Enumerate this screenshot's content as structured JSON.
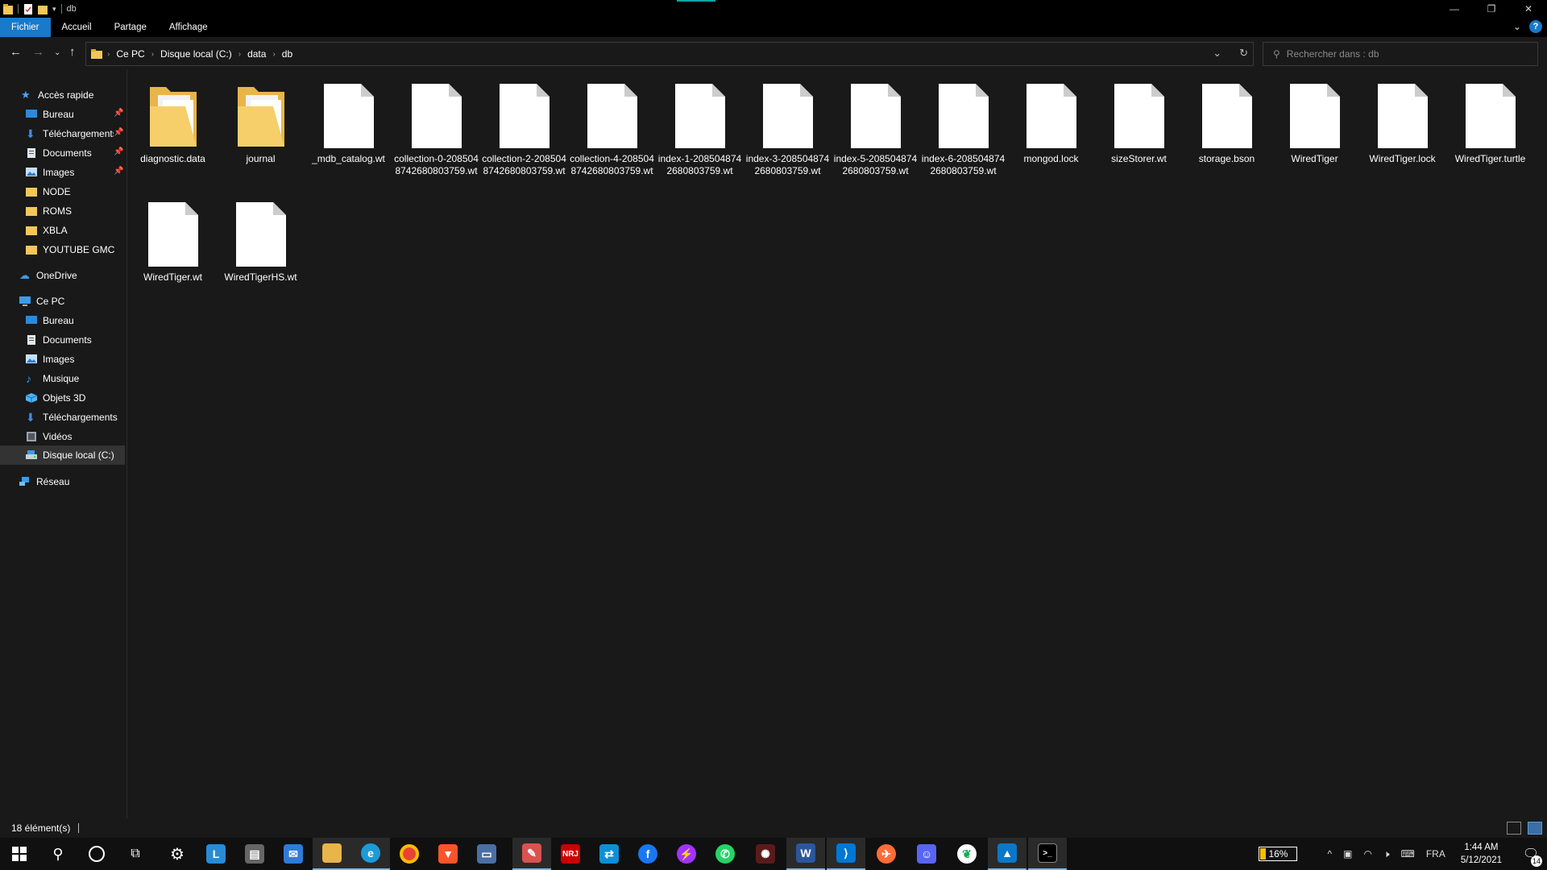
{
  "window": {
    "title": "db"
  },
  "ribbon": {
    "tabs": [
      "Fichier",
      "Accueil",
      "Partage",
      "Affichage"
    ]
  },
  "address": {
    "crumbs": [
      "Ce PC",
      "Disque local (C:)",
      "data",
      "db"
    ]
  },
  "search": {
    "placeholder": "Rechercher dans : db"
  },
  "sidebar": {
    "quick_access": "Accès rapide",
    "quick_items": [
      "Bureau",
      "Téléchargements",
      "Documents",
      "Images",
      "NODE",
      "ROMS",
      "XBLA",
      "YOUTUBE GMC"
    ],
    "onedrive": "OneDrive",
    "this_pc": "Ce PC",
    "pc_items": [
      "Bureau",
      "Documents",
      "Images",
      "Musique",
      "Objets 3D",
      "Téléchargements",
      "Vidéos",
      "Disque local (C:)"
    ],
    "network": "Réseau"
  },
  "files": [
    {
      "name": "diagnostic.data",
      "type": "folder"
    },
    {
      "name": "journal",
      "type": "folder"
    },
    {
      "name": "_mdb_catalog.wt",
      "type": "file"
    },
    {
      "name": "collection-0-2085048742680803759.wt",
      "type": "file"
    },
    {
      "name": "collection-2-2085048742680803759.wt",
      "type": "file"
    },
    {
      "name": "collection-4-2085048742680803759.wt",
      "type": "file"
    },
    {
      "name": "index-1-2085048742680803759.wt",
      "type": "file"
    },
    {
      "name": "index-3-2085048742680803759.wt",
      "type": "file"
    },
    {
      "name": "index-5-2085048742680803759.wt",
      "type": "file"
    },
    {
      "name": "index-6-2085048742680803759.wt",
      "type": "file"
    },
    {
      "name": "mongod.lock",
      "type": "file"
    },
    {
      "name": "sizeStorer.wt",
      "type": "file"
    },
    {
      "name": "storage.bson",
      "type": "file"
    },
    {
      "name": "WiredTiger",
      "type": "file"
    },
    {
      "name": "WiredTiger.lock",
      "type": "file"
    },
    {
      "name": "WiredTiger.turtle",
      "type": "file"
    },
    {
      "name": "WiredTiger.wt",
      "type": "file"
    },
    {
      "name": "WiredTigerHS.wt",
      "type": "file"
    }
  ],
  "status": {
    "count": "18 élément(s)"
  },
  "tray": {
    "battery": "16%",
    "battery_level": 0.16,
    "lang": "FRA",
    "time": "1:44 AM",
    "date": "5/12/2021",
    "notifications": "14"
  }
}
